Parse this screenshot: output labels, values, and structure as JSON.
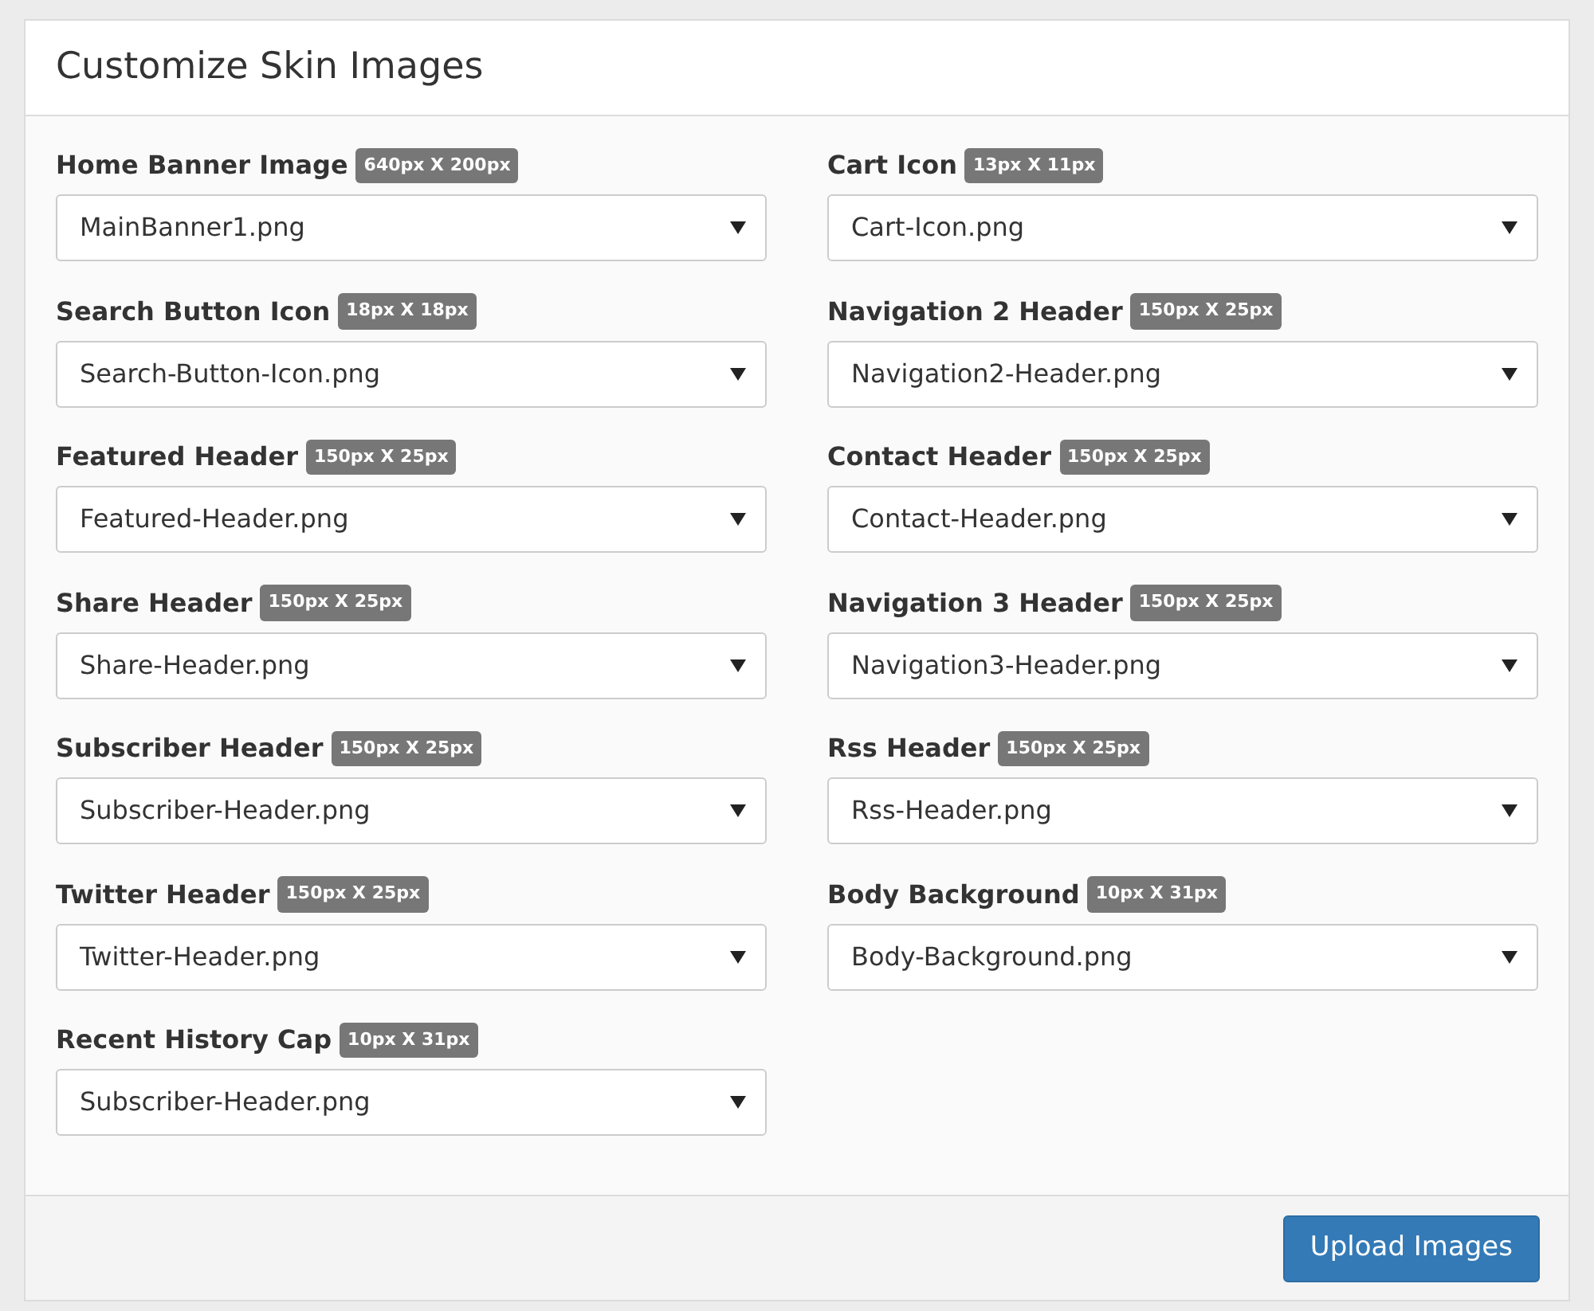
{
  "panel": {
    "title": "Customize Skin Images"
  },
  "fields": [
    {
      "label": "Home Banner Image",
      "size": "640px X 200px",
      "value": "MainBanner1.png"
    },
    {
      "label": "Cart Icon",
      "size": "13px X 11px",
      "value": "Cart-Icon.png"
    },
    {
      "label": "Search Button Icon",
      "size": "18px X 18px",
      "value": "Search-Button-Icon.png"
    },
    {
      "label": "Navigation 2 Header",
      "size": "150px X 25px",
      "value": "Navigation2-Header.png"
    },
    {
      "label": "Featured Header",
      "size": "150px X 25px",
      "value": "Featured-Header.png"
    },
    {
      "label": "Contact Header",
      "size": "150px X 25px",
      "value": "Contact-Header.png"
    },
    {
      "label": "Share Header",
      "size": "150px X 25px",
      "value": "Share-Header.png"
    },
    {
      "label": "Navigation 3 Header",
      "size": "150px X 25px",
      "value": "Navigation3-Header.png"
    },
    {
      "label": "Subscriber Header",
      "size": "150px X 25px",
      "value": "Subscriber-Header.png"
    },
    {
      "label": "Rss Header",
      "size": "150px X 25px",
      "value": "Rss-Header.png"
    },
    {
      "label": "Twitter Header",
      "size": "150px X 25px",
      "value": "Twitter-Header.png"
    },
    {
      "label": "Body Background",
      "size": "10px X 31px",
      "value": "Body-Background.png"
    },
    {
      "label": "Recent History Cap",
      "size": "10px X 31px",
      "value": "Subscriber-Header.png"
    }
  ],
  "footer": {
    "button": "Upload Images"
  }
}
